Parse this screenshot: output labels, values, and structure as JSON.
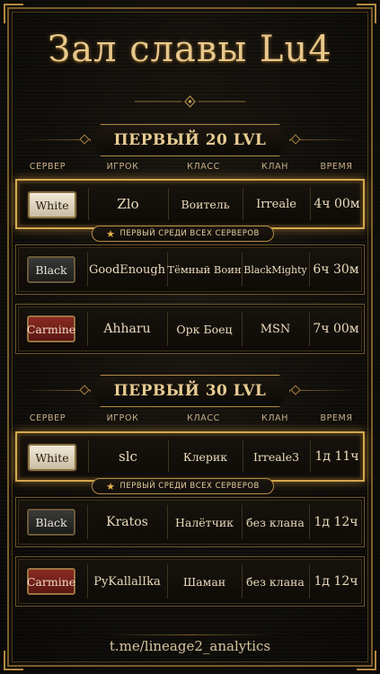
{
  "title": "Зал славы Lu4",
  "columns": {
    "server": "СЕРВЕР",
    "player": "ИГРОК",
    "class": "КЛАСС",
    "clan": "КЛАН",
    "time": "ВРЕМЯ"
  },
  "first_tag": "ПЕРВЫЙ СРЕДИ ВСЕХ СЕРВЕРОВ",
  "sections": [
    {
      "heading": "ПЕРВЫЙ 20 LVL",
      "rows": [
        {
          "server": "White",
          "player": "Zlo",
          "class": "Воитель",
          "clan": "Irreale",
          "time": "4ч 00м"
        },
        {
          "server": "Black",
          "player": "GoodEnough",
          "class": "Тёмный Воин",
          "clan": "BlackMighty",
          "time": "6ч 30м"
        },
        {
          "server": "Carmine",
          "player": "Ahharu",
          "class": "Орк Боец",
          "clan": "MSN",
          "time": "7ч 00м"
        }
      ]
    },
    {
      "heading": "ПЕРВЫЙ 30 LVL",
      "rows": [
        {
          "server": "White",
          "player": "slc",
          "class": "Клерик",
          "clan": "Irreale3",
          "time": "1д 11ч"
        },
        {
          "server": "Black",
          "player": "Kratos",
          "class": "Налётчик",
          "clan": "без клана",
          "time": "1д 12ч"
        },
        {
          "server": "Carmine",
          "player": "PyKallalIka",
          "class": "Шаман",
          "clan": "без клана",
          "time": "1д 12ч"
        }
      ]
    }
  ],
  "footer": "t.me/lineage2_analytics",
  "colors": {
    "gold": "#d4a84f",
    "white_badge": "#e6dcc4",
    "black_badge": "#2a2a28",
    "carmine_badge": "#7a221b"
  }
}
